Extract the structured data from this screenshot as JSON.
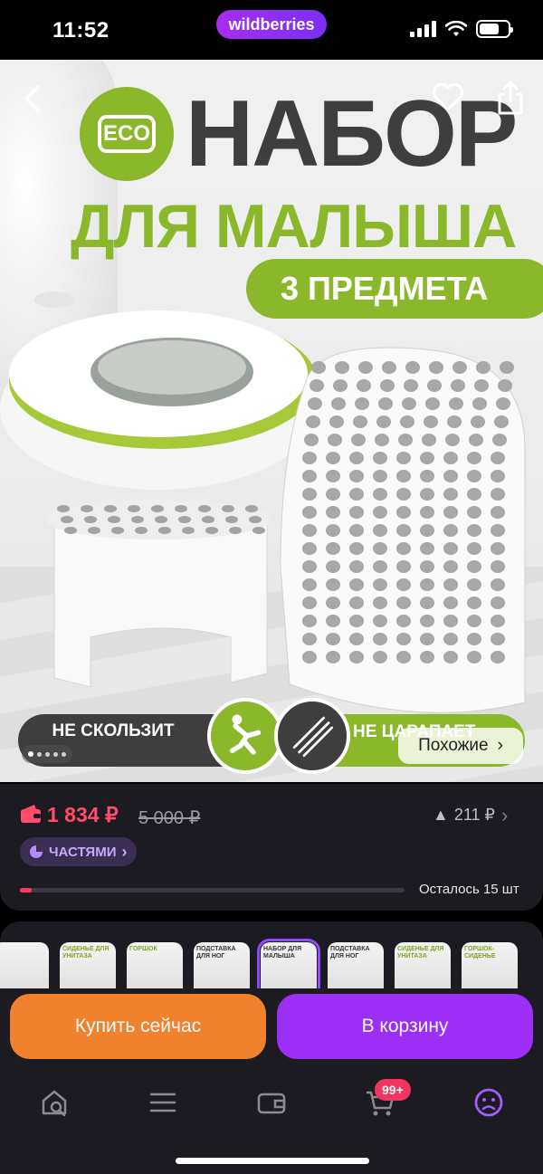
{
  "status_bar": {
    "time": "11:52",
    "app_pill": "wildberries"
  },
  "hero": {
    "eco_label": "ECO",
    "title": "НАБОР",
    "subtitle": "ДЛЯ МАЛЫША",
    "items_pill": "3 ПРЕДМЕТА",
    "feature_left": "НЕ СКОЛЬЗИТ",
    "feature_right": "НЕ ЦАРАПАЕТ",
    "similar_button": "Похожие",
    "gallery_dots": 5,
    "gallery_active_dot": 1
  },
  "price": {
    "current": "1 834 ₽",
    "old": "5 000 ₽",
    "change": "211 ₽",
    "installments": "ЧАСТЯМИ",
    "stock_text": "Осталось 15 шт",
    "stock_fraction": 0.03,
    "accent_color": "#ff4d6a"
  },
  "thumbnails": [
    {
      "label": "",
      "selected": false
    },
    {
      "label": "СИДЕНЬЕ ДЛЯ УНИТАЗА",
      "selected": false
    },
    {
      "label": "ГОРШОК",
      "selected": false
    },
    {
      "label": "ПОДСТАВКА ДЛЯ НОГ",
      "selected": false
    },
    {
      "label": "НАБОР ДЛЯ МАЛЫША",
      "selected": true
    },
    {
      "label": "ПОДСТАВКА ДЛЯ НОГ",
      "selected": false
    },
    {
      "label": "СИДЕНЬЕ ДЛЯ УНИТАЗА",
      "selected": false
    },
    {
      "label": "ГОРШОК-СИДЕНЬЕ",
      "selected": false
    }
  ],
  "actions": {
    "buy_now": "Купить сейчас",
    "add_to_cart": "В корзину"
  },
  "tabbar": {
    "cart_badge": "99+",
    "icons": [
      "home-search-icon",
      "catalog-menu-icon",
      "wallet-icon",
      "cart-icon",
      "profile-icon"
    ],
    "active_color": "#a35cff"
  }
}
